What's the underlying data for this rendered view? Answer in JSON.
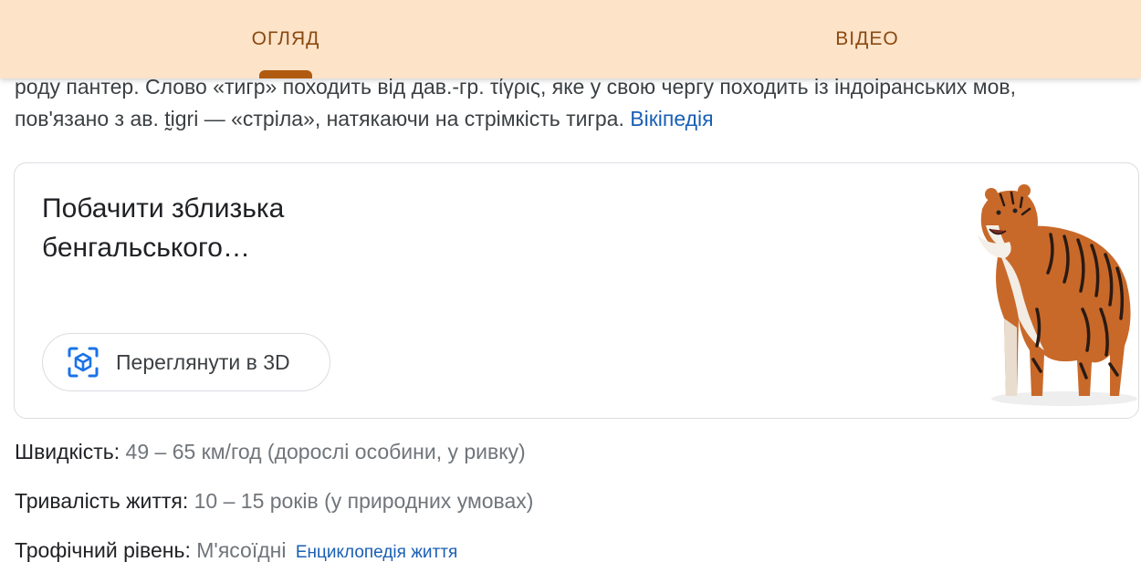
{
  "tabs": {
    "overview": "ОГЛЯД",
    "video": "ВІДЕО"
  },
  "description": {
    "line1": "роду пантер. Слово «тигр» походить від дав.-гр. τίγρις, яке у свою чергу походить із індоіранських мов,",
    "line2": "пов'язано з ав. t̰igri — «стріла», натякаючи на стрімкість тигра.",
    "source_link": "Вікіпедія"
  },
  "card": {
    "title": "Побачити зблизька бенгальського…",
    "button_label": "Переглянути в 3D",
    "image_name": "bengal-tiger-3d-model"
  },
  "facts": {
    "speed": {
      "label": "Швидкість:",
      "value": "49 – 65 км/год (дорослі особини, у ривку)"
    },
    "lifespan": {
      "label": "Тривалість життя:",
      "value": "10 – 15 років (у природних умовах)"
    },
    "trophic": {
      "label": "Трофічний рівень:",
      "value": "М'ясоїдні",
      "source": "Енциклопедія життя"
    }
  },
  "colors": {
    "tab_bar_bg": "#fde3c8",
    "tab_text": "#8a4a12",
    "tab_indicator": "#b05a10",
    "link": "#1a5fb4",
    "icon_3d": "#1a73e8"
  }
}
